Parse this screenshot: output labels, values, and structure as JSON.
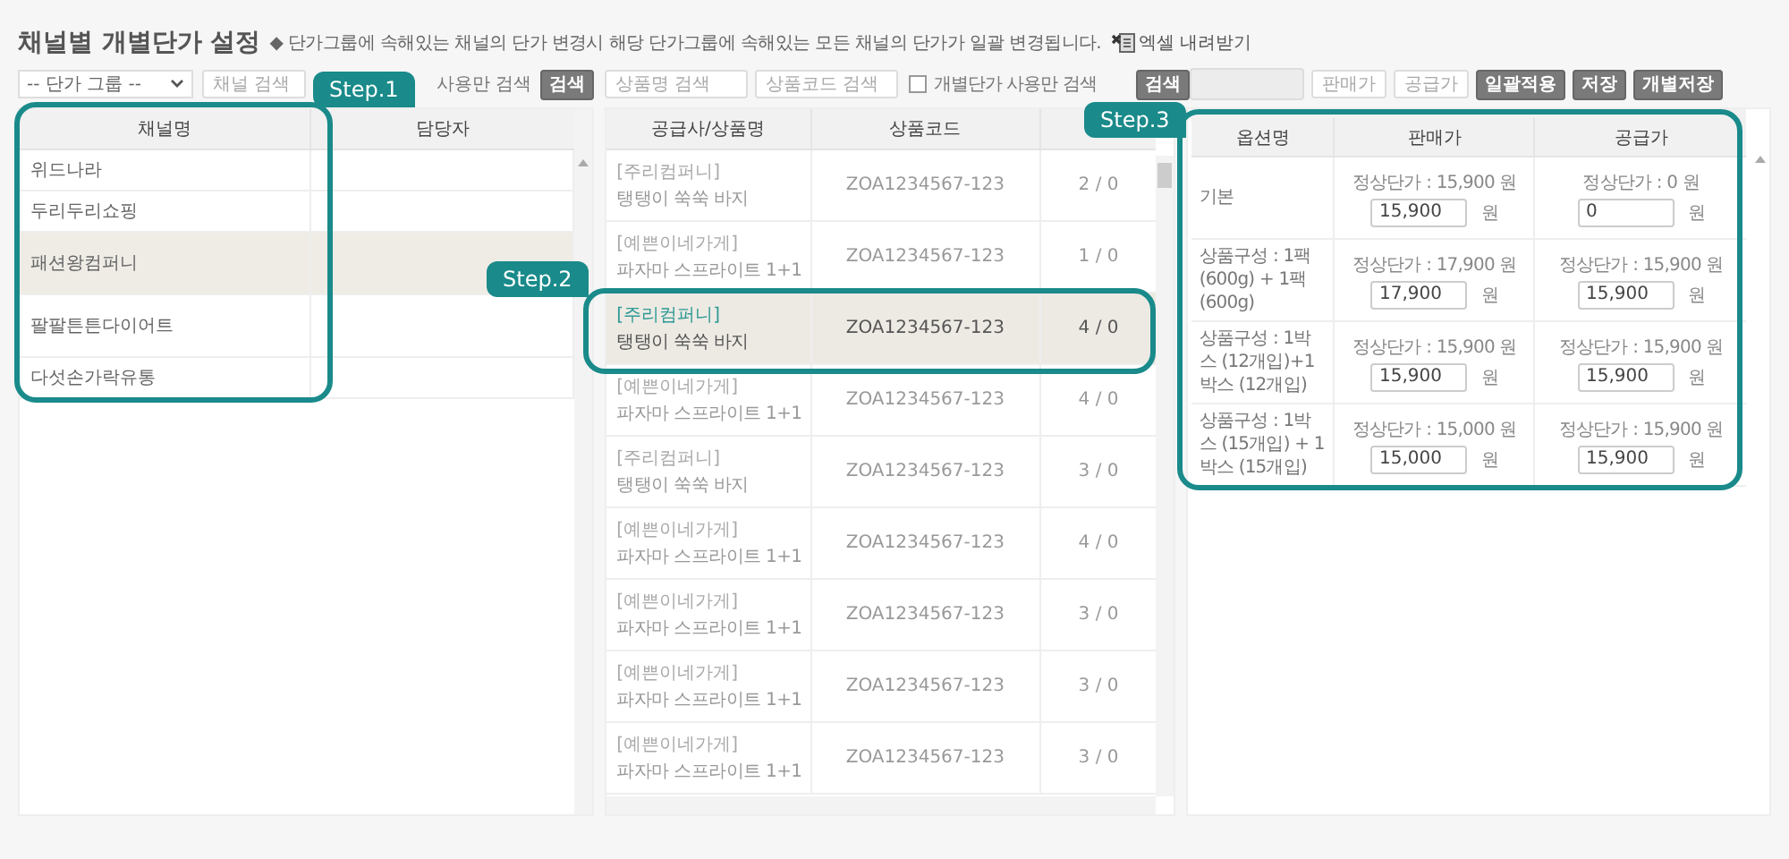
{
  "title": "채널별 개별단가 설정",
  "notice": "◆ 단가그룹에 속해있는 채널의 단가 변경시 해당 단가그룹에 속해있는 모든 채널의 단가가 일괄 변경됩니다.",
  "excel_link": "엑셀 내려받기",
  "channel_filter": {
    "group_select": "-- 단가 그룹 --",
    "search_placeholder": "채널 검색",
    "checkbox_label": "사용만 검색",
    "search_button": "검색"
  },
  "product_filter": {
    "name_placeholder": "상품명 검색",
    "code_placeholder": "상품코드 검색",
    "checkbox_label": "개별단가 사용만 검색",
    "checked": false,
    "search_button": "검색"
  },
  "bulk": {
    "sale_placeholder": "판매가",
    "supply_placeholder": "공급가",
    "buttons": [
      "일괄적용",
      "저장",
      "개별저장"
    ]
  },
  "channels": {
    "columns": [
      "채널명",
      "담당자"
    ],
    "rows": [
      {
        "name": "위드나라",
        "selected": false
      },
      {
        "name": "두리두리쇼핑",
        "selected": false
      },
      {
        "name": "패션왕컴퍼니",
        "selected": true
      },
      {
        "name": "팔팔튼튼다이어트",
        "selected": false
      },
      {
        "name": "다섯손가락유통",
        "selected": false
      }
    ]
  },
  "products": {
    "columns": [
      "공급사/상품명",
      "상품코드"
    ],
    "rows": [
      {
        "supplier": "[주리컴퍼니]",
        "name": "탱탱이 쑥쑥 바지",
        "code": "ZOA1234567-123",
        "count": "2 / 0",
        "selected": false
      },
      {
        "supplier": "[예쁜이네가게]",
        "name": "파자마 스프라이트 1+1",
        "code": "ZOA1234567-123",
        "count": "1 / 0",
        "selected": false
      },
      {
        "supplier": "[주리컴퍼니]",
        "name": "탱탱이 쑥쑥 바지",
        "code": "ZOA1234567-123",
        "count": "4 / 0",
        "selected": true
      },
      {
        "supplier": "[예쁜이네가게]",
        "name": "파자마 스프라이트 1+1",
        "code": "ZOA1234567-123",
        "count": "4 / 0",
        "selected": false
      },
      {
        "supplier": "[주리컴퍼니]",
        "name": "탱탱이 쑥쑥 바지",
        "code": "ZOA1234567-123",
        "count": "3 / 0",
        "selected": false
      },
      {
        "supplier": "[예쁜이네가게]",
        "name": "파자마 스프라이트 1+1",
        "code": "ZOA1234567-123",
        "count": "4 / 0",
        "selected": false
      },
      {
        "supplier": "[예쁜이네가게]",
        "name": "파자마 스프라이트 1+1",
        "code": "ZOA1234567-123",
        "count": "3 / 0",
        "selected": false
      },
      {
        "supplier": "[예쁜이네가게]",
        "name": "파자마 스프라이트 1+1",
        "code": "ZOA1234567-123",
        "count": "3 / 0",
        "selected": false
      },
      {
        "supplier": "[예쁜이네가게]",
        "name": "파자마 스프라이트 1+1",
        "code": "ZOA1234567-123",
        "count": "3 / 0",
        "selected": false
      }
    ]
  },
  "options": {
    "columns": [
      "옵션명",
      "판매가",
      "공급가"
    ],
    "rows": [
      {
        "name": "기본",
        "sale_normal": "정상단가 : 15,900 원",
        "sale_value": "15,900",
        "sale_unit": "원",
        "supply_normal": "정상단가 : 0 원",
        "supply_value": "0",
        "supply_unit": "원"
      },
      {
        "name": "상품구성 : 1팩 (600g) + 1팩 (600g)",
        "sale_normal": "정상단가 : 17,900 원",
        "sale_value": "17,900",
        "sale_unit": "원",
        "supply_normal": "정상단가 : 15,900 원",
        "supply_value": "15,900",
        "supply_unit": "원"
      },
      {
        "name": "상품구성 : 1박스 (12개입)+1박스 (12개입)",
        "sale_normal": "정상단가 : 15,900 원",
        "sale_value": "15,900",
        "sale_unit": "원",
        "supply_normal": "정상단가 : 15,900 원",
        "supply_value": "15,900",
        "supply_unit": "원"
      },
      {
        "name": "상품구성 : 1박스 (15개입) + 1박스 (15개입)",
        "sale_normal": "정상단가 : 15,000 원",
        "sale_value": "15,000",
        "sale_unit": "원",
        "supply_normal": "정상단가 : 15,900 원",
        "supply_value": "15,900",
        "supply_unit": "원"
      }
    ]
  },
  "callouts": [
    {
      "label": "Step.1"
    },
    {
      "label": "Step.2"
    },
    {
      "label": "Step.3"
    }
  ]
}
